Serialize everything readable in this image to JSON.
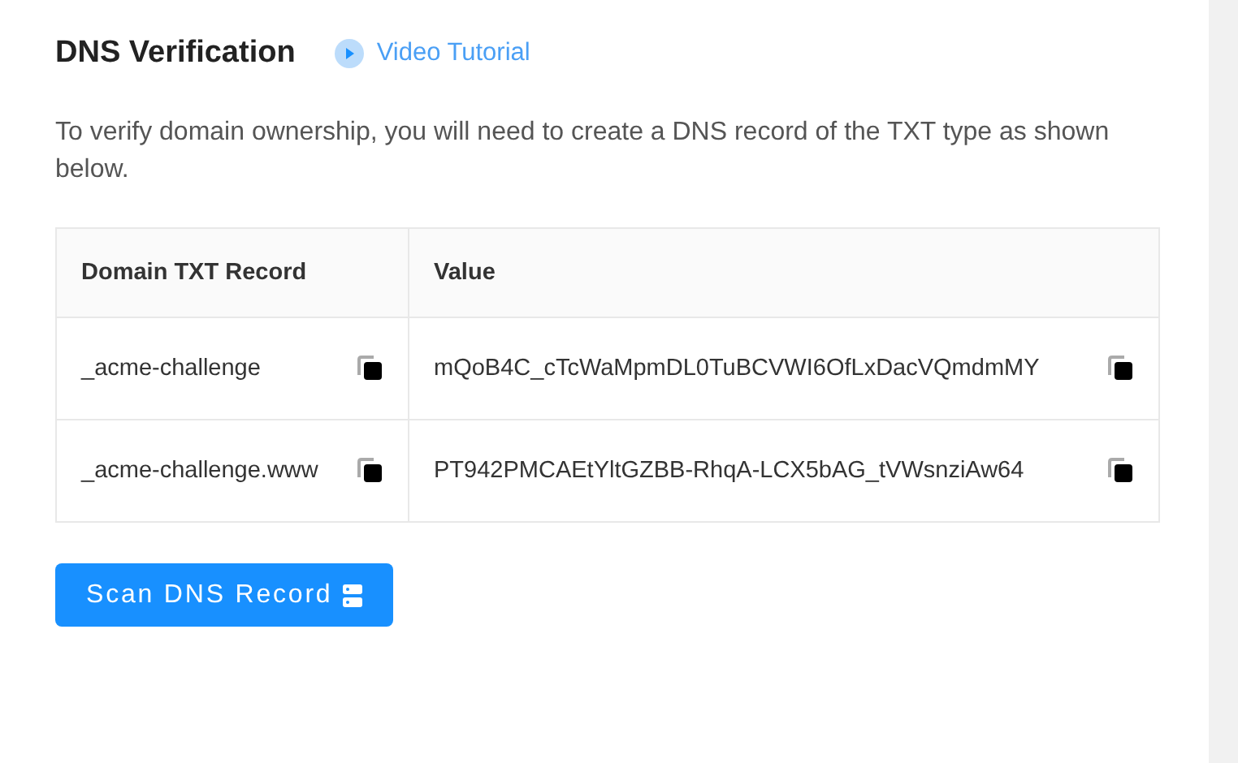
{
  "title": "DNS Verification",
  "tutorial_link": "Video Tutorial",
  "description": "To verify domain ownership, you will need to create a DNS record of the TXT type as shown below.",
  "table": {
    "columns": [
      "Domain TXT Record",
      "Value"
    ],
    "rows": [
      {
        "record": "_acme-challenge",
        "value": "mQoB4C_cTcWaMpmDL0TuBCVWI6OfLxDacVQmdmMY"
      },
      {
        "record": "_acme-challenge.www",
        "value": "PT942PMCAEtYltGZBB-RhqA-LCX5bAG_tVWsnziAw64"
      }
    ]
  },
  "scan_button": "Scan DNS Record"
}
